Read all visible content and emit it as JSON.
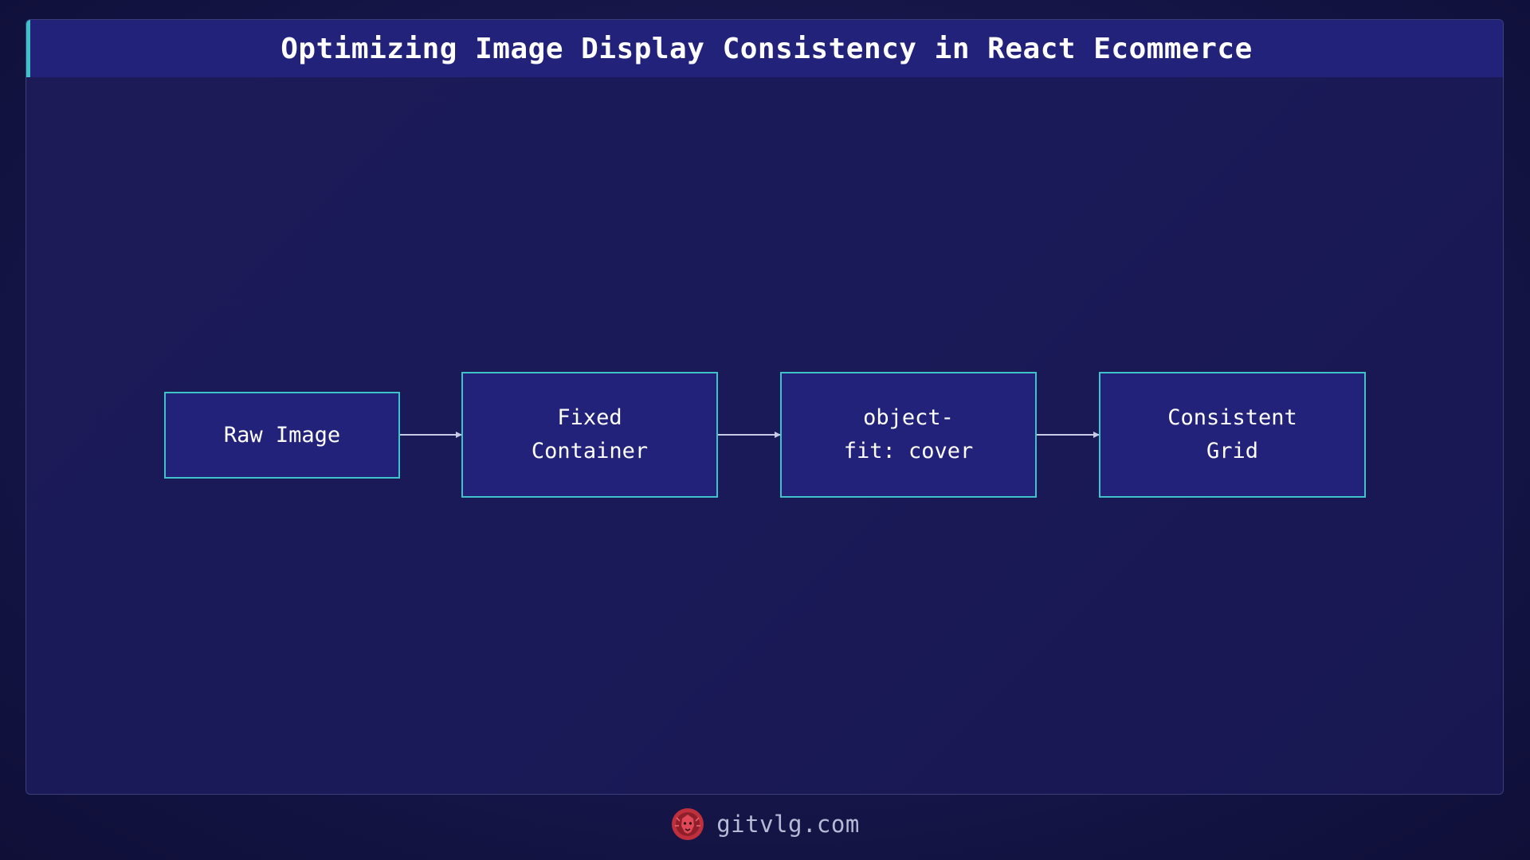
{
  "title": "Optimizing Image Display Consistency in React Ecommerce",
  "nodes": [
    {
      "label": "Raw Image"
    },
    {
      "label": "Fixed\nContainer"
    },
    {
      "label": "object-\nfit: cover"
    },
    {
      "label": "Consistent\nGrid"
    }
  ],
  "edges": [
    {
      "from": "Raw Image",
      "to": "Fixed Container"
    },
    {
      "from": "Fixed Container",
      "to": "object-fit: cover"
    },
    {
      "from": "object-fit: cover",
      "to": "Consistent Grid"
    }
  ],
  "footer": {
    "site": "gitvlg.com",
    "logo_icon": "lion-head-icon"
  },
  "colors": {
    "background": "#16164a",
    "panel_header": "#22227a",
    "accent": "#3fc3c8",
    "node_fill": "#22227a",
    "text": "#ffffff",
    "logo": "#c0303c"
  }
}
